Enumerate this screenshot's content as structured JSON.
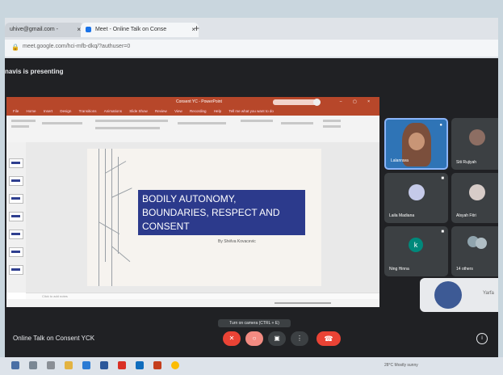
{
  "browser": {
    "tabs": [
      {
        "label": "uhive@gmail.com -"
      },
      {
        "label": "Meet - Online Talk on Conse"
      }
    ],
    "new_tab": "+",
    "close": "×",
    "url": "meet.google.com/hci-mfb-dkq/?authuser=0"
  },
  "meet": {
    "presenting_text": "navis is presenting",
    "meeting_name": "Online Talk on Consent YCK",
    "tooltip": "Turn on camera (CTRL + E)",
    "participants": [
      {
        "name": "Lalanrava"
      },
      {
        "name": "Siti Rujiyah"
      },
      {
        "name": "Laila Madiana"
      },
      {
        "name": "Alsyah Fitri"
      },
      {
        "name": "Ning Hinna"
      },
      {
        "name": "14 others"
      }
    ],
    "self_name": "Yarfa",
    "controls": {
      "mic_icon": "mic-off-icon",
      "camera_icon": "camera-off-icon",
      "present_icon": "present-icon",
      "more_icon": "more-icon",
      "leave_icon": "phone-icon",
      "info_icon": "info-icon"
    },
    "colors": {
      "red": "#ea4335",
      "bg": "#202124",
      "tile": "#3c4043",
      "active_tile": "#2f74b6"
    }
  },
  "powerpoint": {
    "window_title": "Consent YC - PowerPoint",
    "menu": [
      "File",
      "Home",
      "Insert",
      "Design",
      "Transitions",
      "Animations",
      "Slide Show",
      "Review",
      "View",
      "Recording",
      "Help",
      "Tell me what you want to do"
    ],
    "slide_title": "BODILY AUTONOMY, BOUNDARIES, RESPECT AND CONSENT",
    "slide_subtitle": "By Shélva Kovacevic",
    "notes_placeholder": "Click to add notes",
    "accent_color": "#b7472a",
    "title_box_color": "#2c3a8c"
  },
  "taskbar": {
    "weather": "28°C Mostly sunny",
    "icons": [
      "start-icon",
      "search-icon",
      "task-view-icon",
      "explorer-icon",
      "edge-icon",
      "word-icon",
      "acrobat-icon",
      "outlook-icon",
      "powerpoint-icon",
      "chrome-icon"
    ]
  }
}
